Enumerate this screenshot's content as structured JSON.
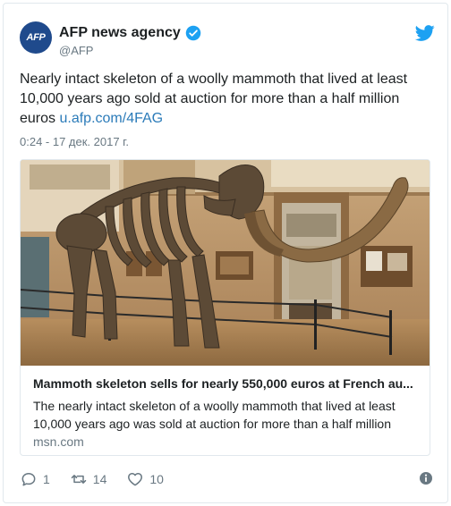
{
  "account": {
    "name": "AFP news agency",
    "handle": "@AFP",
    "avatar_text": "AFP"
  },
  "tweet": {
    "text": "Nearly intact skeleton of a woolly mammoth that lived at least 10,000 years ago sold at auction for more than a half million euros",
    "link": "u.afp.com/4FAG",
    "timestamp": "0:24 - 17 дек. 2017 г."
  },
  "link_card": {
    "title": "Mammoth skeleton sells for nearly 550,000 euros at French au...",
    "description": "The nearly intact skeleton of a woolly mammoth that lived at least 10,000 years ago was sold at auction for more than a half million",
    "domain": "msn.com"
  },
  "actions": {
    "reply_count": "1",
    "retweet_count": "14",
    "like_count": "10"
  },
  "colors": {
    "link": "#2b7bb9",
    "verified": "#1da1f2",
    "twitter_bird": "#1da1f2",
    "secondary_text": "#697882"
  },
  "icons": [
    "verified-badge-icon",
    "twitter-bird-icon",
    "reply-icon",
    "retweet-icon",
    "heart-icon",
    "info-icon"
  ]
}
